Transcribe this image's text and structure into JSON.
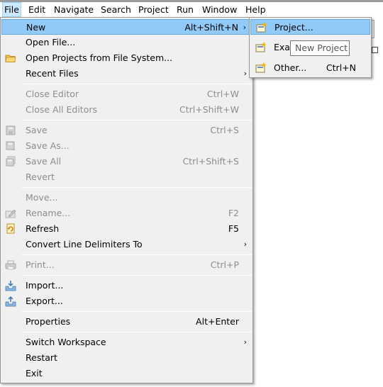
{
  "menubar": {
    "items": [
      {
        "label": "File"
      },
      {
        "label": "Edit"
      },
      {
        "label": "Navigate"
      },
      {
        "label": "Search"
      },
      {
        "label": "Project"
      },
      {
        "label": "Run"
      },
      {
        "label": "Window"
      },
      {
        "label": "Help"
      }
    ],
    "active": "File"
  },
  "file_menu": {
    "items": [
      {
        "label": "New",
        "shortcut": "Alt+Shift+N",
        "submenu": true,
        "highlighted": true
      },
      {
        "label": "Open File..."
      },
      {
        "label": "Open Projects from File System...",
        "icon": "folder-icon"
      },
      {
        "label": "Recent Files",
        "submenu": true
      },
      {
        "label": "Close Editor",
        "shortcut": "Ctrl+W",
        "disabled": true
      },
      {
        "label": "Close All Editors",
        "shortcut": "Ctrl+Shift+W",
        "disabled": true
      },
      {
        "label": "Save",
        "shortcut": "Ctrl+S",
        "disabled": true,
        "icon": "save-icon"
      },
      {
        "label": "Save As...",
        "disabled": true,
        "icon": "save-as-icon"
      },
      {
        "label": "Save All",
        "shortcut": "Ctrl+Shift+S",
        "disabled": true,
        "icon": "save-all-icon"
      },
      {
        "label": "Revert",
        "disabled": true
      },
      {
        "label": "Move...",
        "disabled": true
      },
      {
        "label": "Rename...",
        "shortcut": "F2",
        "disabled": true,
        "icon": "rename-icon"
      },
      {
        "label": "Refresh",
        "shortcut": "F5",
        "icon": "refresh-icon"
      },
      {
        "label": "Convert Line Delimiters To",
        "submenu": true
      },
      {
        "label": "Print...",
        "shortcut": "Ctrl+P",
        "disabled": true,
        "icon": "print-icon"
      },
      {
        "label": "Import...",
        "icon": "import-icon"
      },
      {
        "label": "Export...",
        "icon": "export-icon"
      },
      {
        "label": "Properties",
        "shortcut": "Alt+Enter"
      },
      {
        "label": "Switch Workspace",
        "submenu": true
      },
      {
        "label": "Restart"
      },
      {
        "label": "Exit"
      }
    ]
  },
  "new_submenu": {
    "items": [
      {
        "label": "Project...",
        "icon": "new-project-icon",
        "highlighted": true
      },
      {
        "label": "Exar",
        "icon": "new-example-icon"
      },
      {
        "label": "Other...",
        "shortcut": "Ctrl+N",
        "icon": "new-wizard-icon"
      }
    ]
  },
  "tooltip": {
    "text": "New Project"
  },
  "submenu_arrow": "›"
}
